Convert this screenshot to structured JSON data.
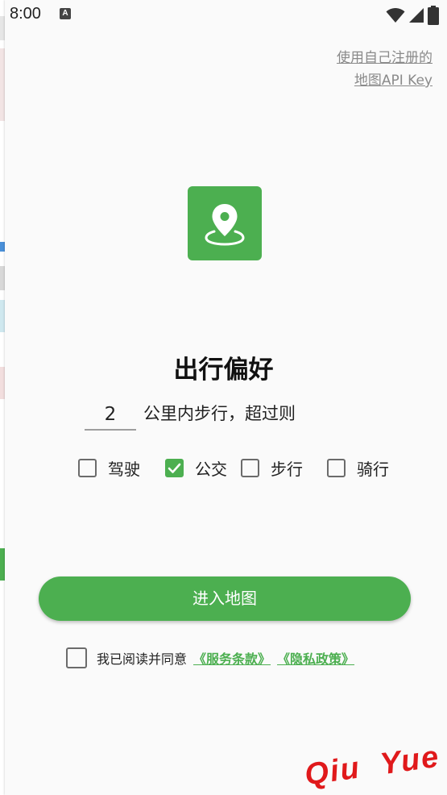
{
  "status_bar": {
    "time": "8:00",
    "notification_badge": "A",
    "icons": [
      "wifi-icon",
      "cellular-signal-icon",
      "battery-icon"
    ]
  },
  "api_key_link": {
    "line1": "使用自己注册的",
    "line2": "地图API Key"
  },
  "logo": {
    "icon": "map-pin-icon",
    "color": "#4caf50"
  },
  "title": "出行偏好",
  "distance": {
    "value": "2",
    "suffix": "公里内步行，超过则"
  },
  "modes": [
    {
      "label": "驾驶",
      "checked": false
    },
    {
      "label": "公交",
      "checked": true
    },
    {
      "label": "步行",
      "checked": false
    },
    {
      "label": "骑行",
      "checked": false
    }
  ],
  "enter_button": "进入地图",
  "agreement": {
    "checked": false,
    "text": "我已阅读并同意",
    "terms": "《服务条款》",
    "privacy": "《隐私政策》"
  },
  "watermark": "Qiu  Yue",
  "colors": {
    "accent": "#4caf50",
    "link_gray": "#8a8a8a",
    "watermark": "#e0191b"
  }
}
